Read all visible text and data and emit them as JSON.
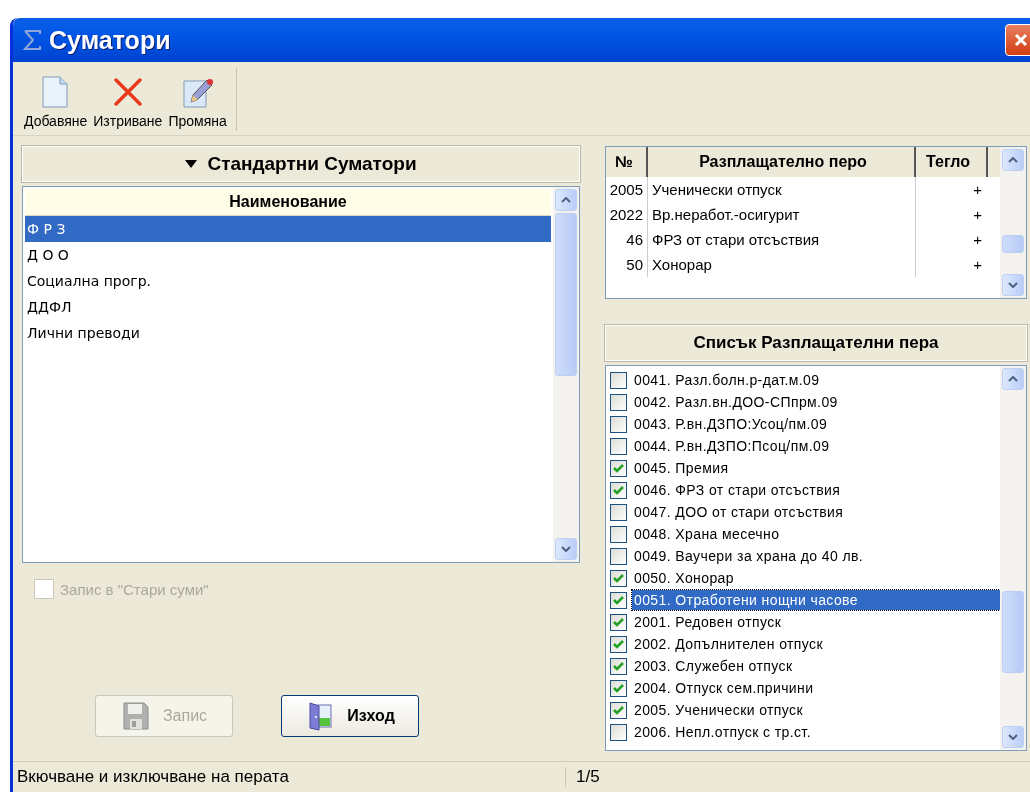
{
  "window": {
    "title": "Суматори"
  },
  "toolbar": {
    "buttons": [
      {
        "kind": "add",
        "label": "Добавяне"
      },
      {
        "kind": "delete",
        "label": "Изтриване"
      },
      {
        "kind": "edit",
        "label": "Промяна"
      }
    ]
  },
  "left_panel": {
    "header": "Стандартни Суматори",
    "column": "Наименование",
    "rows": [
      {
        "name": "Ф Р З",
        "selected": true
      },
      {
        "name": "Д О О",
        "selected": false
      },
      {
        "name": "Социална прогр.",
        "selected": false
      },
      {
        "name": "ДДФЛ",
        "selected": false
      },
      {
        "name": "Лични преводи",
        "selected": false
      }
    ],
    "archive_checkbox": {
      "label": "Запис в \"Стари суми\"",
      "checked": false,
      "disabled": true
    },
    "buttons": [
      {
        "kind": "save",
        "label": "Запис",
        "disabled": true
      },
      {
        "kind": "exit",
        "label": "Изход",
        "disabled": false
      }
    ]
  },
  "items_table": {
    "columns": [
      "№",
      "Разплащателно перо",
      "Тегло"
    ],
    "rows": [
      {
        "number": "2005",
        "name": "Ученически отпуск",
        "weight": "+"
      },
      {
        "number": "2022",
        "name": "Вр.неработ.-осигурит",
        "weight": "+"
      },
      {
        "number": "46",
        "name": "ФРЗ от стари отсъствия",
        "weight": "+"
      },
      {
        "number": "50",
        "name": "Хонорар",
        "weight": "+"
      }
    ]
  },
  "items_list": {
    "header": "Списък Разплащателни пера",
    "items": [
      {
        "label": "0041. Разл.болн.р-дат.м.09",
        "checked": false,
        "selected": false
      },
      {
        "label": "0042. Разл.вн.ДОО-СПпрм.09",
        "checked": false,
        "selected": false
      },
      {
        "label": "0043. Р.вн.ДЗПО:Усоц/пм.09",
        "checked": false,
        "selected": false
      },
      {
        "label": "0044. Р.вн.ДЗПО:Псоц/пм.09",
        "checked": false,
        "selected": false
      },
      {
        "label": "0045. Премия",
        "checked": true,
        "selected": false
      },
      {
        "label": "0046. ФРЗ от стари отсъствия",
        "checked": true,
        "selected": false
      },
      {
        "label": "0047. ДОО от стари отсъствия",
        "checked": false,
        "selected": false
      },
      {
        "label": "0048. Храна месечно",
        "checked": false,
        "selected": false
      },
      {
        "label": "0049. Ваучери за храна до 40 лв.",
        "checked": false,
        "selected": false
      },
      {
        "label": "0050. Хонорар",
        "checked": true,
        "selected": false
      },
      {
        "label": "0051. Отработени нощни часове",
        "checked": true,
        "selected": true
      },
      {
        "label": "2001. Редовен отпуск",
        "checked": true,
        "selected": false
      },
      {
        "label": "2002. Допълнителен отпуск",
        "checked": true,
        "selected": false
      },
      {
        "label": "2003. Служебен отпуск",
        "checked": true,
        "selected": false
      },
      {
        "label": "2004. Отпуск сем.причини",
        "checked": true,
        "selected": false
      },
      {
        "label": "2005. Ученически отпуск",
        "checked": true,
        "selected": false
      },
      {
        "label": "2006. Непл.отпуск с тр.ст.",
        "checked": false,
        "selected": false
      }
    ]
  },
  "status_bar": {
    "message": "Вкючване и изключване на перата",
    "page": "1/5"
  }
}
